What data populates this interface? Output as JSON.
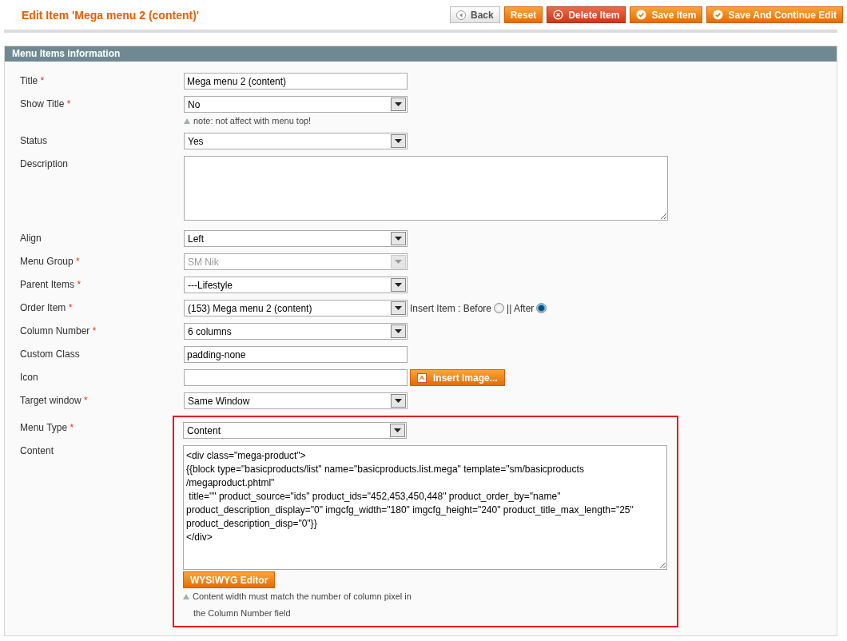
{
  "header": {
    "title": "Edit Item 'Mega menu 2 (content)'",
    "buttons": [
      {
        "label": "Back",
        "kind": "back"
      },
      {
        "label": "Reset",
        "kind": "plain"
      },
      {
        "label": "Delete Item",
        "kind": "delete"
      },
      {
        "label": "Save Item",
        "kind": "save"
      },
      {
        "label": "Save And Continue Edit",
        "kind": "save"
      }
    ]
  },
  "section": {
    "title": "Menu Items information"
  },
  "fields": [
    {
      "label": "Title",
      "required_mark": "*",
      "kind": "text",
      "value": "Mega menu 2 (content)",
      "highlighted": false
    },
    {
      "label": "Show Title",
      "required_mark": "*",
      "kind": "select",
      "value": "No",
      "disabled": false,
      "note": "note: not affect with menu top!",
      "highlighted": false
    },
    {
      "label": "Status",
      "kind": "select",
      "value": "Yes",
      "disabled": false,
      "highlighted": false
    },
    {
      "label": "Description",
      "kind": "textarea",
      "highlighted": false
    },
    {
      "label": "Align",
      "kind": "select",
      "value": "Left",
      "disabled": false,
      "highlighted": false
    },
    {
      "label": "Menu Group",
      "required_mark": "*",
      "kind": "select",
      "value": "SM Nik",
      "disabled": true,
      "highlighted": false
    },
    {
      "label": "Parent Items",
      "required_mark": "*",
      "kind": "select",
      "value": "---Lifestyle",
      "disabled": false,
      "highlighted": false
    },
    {
      "label": "Order Item",
      "required_mark": "*",
      "kind": "select",
      "value": "(153) Mega menu 2 (content)",
      "disabled": false,
      "highlighted": false,
      "radios": [
        {
          "label": "Insert Item : Before",
          "selected": false
        },
        {
          "label": "|| After",
          "selected": true
        }
      ]
    },
    {
      "label": "Column Number",
      "required_mark": "*",
      "kind": "select",
      "value": "6 columns",
      "disabled": false,
      "highlighted": false
    },
    {
      "label": "Custom Class",
      "kind": "text",
      "value": "padding-none",
      "highlighted": false
    },
    {
      "label": "Icon",
      "kind": "text",
      "button": "Insert Image...",
      "highlighted": false
    },
    {
      "label": "Target window",
      "required_mark": "*",
      "kind": "select",
      "value": "Same Window",
      "disabled": false,
      "highlighted": false
    },
    {
      "label": "Menu Type",
      "required_mark": "*",
      "kind": "select",
      "value": "Content",
      "disabled": false,
      "highlighted": true
    },
    {
      "label": "Content",
      "kind": "editor",
      "value": "<div class=\"mega-product\">\n{{block type=\"basicproducts/list\" name=\"basicproducts.list.mega\" template=\"sm/basicproducts\n/megaproduct.phtml\"\n title=\"\" product_source=\"ids\" product_ids=\"452,453,450,448\" product_order_by=\"name\"\nproduct_description_display=\"0\" imgcfg_width=\"180\" imgcfg_height=\"240\" product_title_max_length=\"25\"\nproduct_description_disp=\"0\"}}\n</div>",
      "button": "WYSIWYG Editor",
      "note": "Content width must match the number of column pixel in",
      "note_continued": "the Column Number field",
      "highlighted": true
    }
  ]
}
